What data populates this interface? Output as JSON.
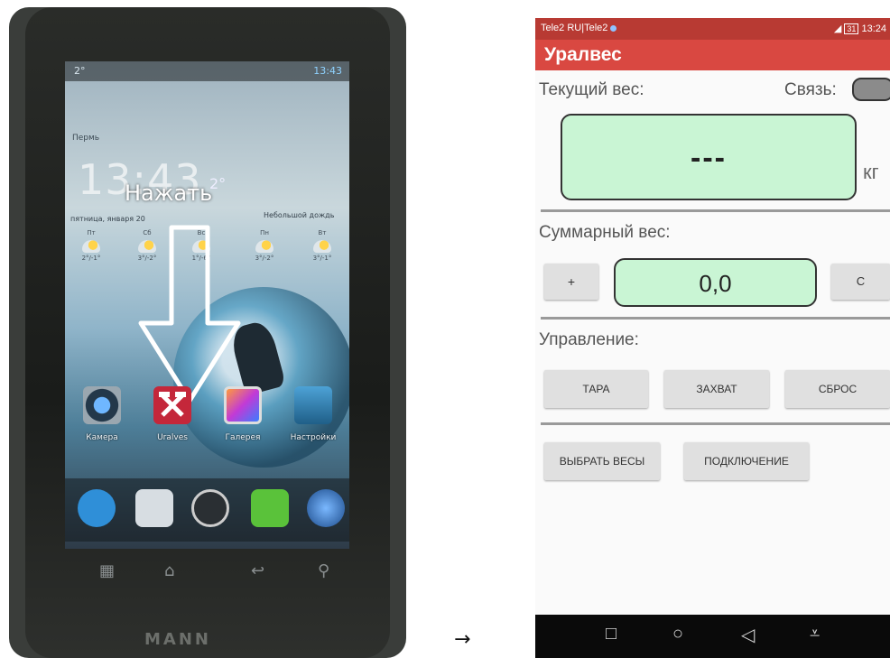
{
  "photo": {
    "status_left": "2°",
    "status_time": "13:43",
    "city": "Пермь",
    "clock": "13:43",
    "temperature": "2°",
    "date": "пятница, января 20",
    "forecast": "Небольшой дождь",
    "days": [
      {
        "name": "Пт",
        "temp": "2°/-1°"
      },
      {
        "name": "Сб",
        "temp": "3°/-2°"
      },
      {
        "name": "Вс",
        "temp": "1°/-6°"
      },
      {
        "name": "Пн",
        "temp": "3°/-2°"
      },
      {
        "name": "Вт",
        "temp": "3°/-1°"
      }
    ],
    "annotation": "Нажать",
    "apps": [
      {
        "label": "Камера",
        "icon": "camera-icon"
      },
      {
        "label": "Uralves",
        "icon": "hammer-icon"
      },
      {
        "label": "Галерея",
        "icon": "gallery-icon"
      },
      {
        "label": "Настройки",
        "icon": "settings-icon"
      }
    ],
    "dock": [
      "phone-icon",
      "contacts-icon",
      "apps-grid-icon",
      "messages-icon",
      "browser-icon"
    ],
    "brand": "MANN"
  },
  "between_arrow": "→",
  "app": {
    "status": {
      "carrier": "Tele2 RU|Tele2",
      "battery": "31",
      "time": "13:24"
    },
    "title": "Уралвес",
    "current_weight_label": "Текущий вес:",
    "connection_label": "Связь:",
    "current_weight_value": "---",
    "unit": "кг",
    "sum_label": "Суммарный вес:",
    "plus_button": "+",
    "sum_value": "0,0",
    "clear_button": "C",
    "control_label": "Управление:",
    "buttons": {
      "tare": "ТАРА",
      "capture": "ЗАХВАТ",
      "reset": "СБРОС",
      "select_scales": "ВЫБРАТЬ ВЕСЫ",
      "connect": "ПОДКЛЮЧЕНИЕ"
    },
    "colors": {
      "status_bar": "#b83a33",
      "app_bar": "#d94841",
      "display_fill": "#c9f5d4"
    },
    "nav": [
      "square-icon",
      "circle-home-icon",
      "back-triangle-icon",
      "notification-down-icon"
    ]
  }
}
